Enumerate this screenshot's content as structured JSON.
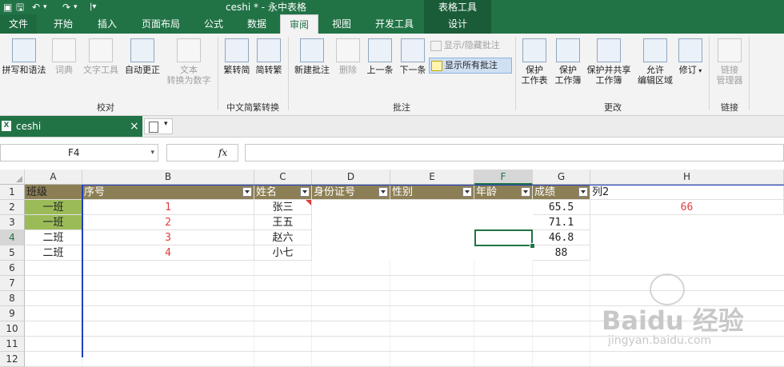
{
  "titlebar": {
    "title": "ceshi * - 永中表格",
    "context_tool": "表格工具"
  },
  "tabs": [
    "文件",
    "开始",
    "插入",
    "页面布局",
    "公式",
    "数据",
    "审阅",
    "视图",
    "开发工具",
    "设计"
  ],
  "active_tab": "审阅",
  "ribbon": {
    "proofing": {
      "spell": "拼写和语法",
      "dict": "词典",
      "text_tools": "文字工具",
      "autocorrect": "自动更正",
      "convert_l1": "文本",
      "convert_l2": "转换为数字",
      "group": "校对"
    },
    "chinese": {
      "to_trad": "繁转简",
      "to_simp": "简转繁",
      "group": "中文简繁转换"
    },
    "comments": {
      "new": "新建批注",
      "delete": "删除",
      "prev": "上一条",
      "next": "下一条",
      "show_hide": "显示/隐藏批注",
      "show_all": "显示所有批注",
      "group": "批注"
    },
    "changes": {
      "protect_sheet_l1": "保护",
      "protect_sheet_l2": "工作表",
      "protect_book_l1": "保护",
      "protect_book_l2": "工作簿",
      "protect_share_l1": "保护并共享",
      "protect_share_l2": "工作簿",
      "allow_l1": "允许",
      "allow_l2": "编辑区域",
      "revise": "修订",
      "group": "更改"
    },
    "links": {
      "manager_l1": "链接",
      "manager_l2": "管理器",
      "group": "链接"
    }
  },
  "doc_tab": {
    "name": "ceshi",
    "close": "×"
  },
  "formula_bar": {
    "name_box": "F4",
    "fx": "fx",
    "formula": ""
  },
  "columns": [
    "A",
    "B",
    "C",
    "D",
    "E",
    "F",
    "G",
    "H"
  ],
  "rows": [
    "1",
    "2",
    "3",
    "4",
    "5",
    "6",
    "7",
    "8",
    "9",
    "10",
    "11",
    "12"
  ],
  "header_row": {
    "A": "班级",
    "B": "序号",
    "C": "姓名",
    "D": "身份证号",
    "E": "性别",
    "F": "年龄",
    "G": "成绩",
    "H": "列2"
  },
  "data_rows": [
    {
      "A": "一班",
      "B": "1",
      "C": "张三",
      "G": "65.5",
      "H": "66"
    },
    {
      "A": "一班",
      "B": "2",
      "C": "王五",
      "G": "71.1",
      "H": ""
    },
    {
      "A": "二班",
      "B": "3",
      "C": "赵六",
      "G": "46.8",
      "H": ""
    },
    {
      "A": "二班",
      "B": "4",
      "C": "小七",
      "G": "88",
      "H": ""
    }
  ],
  "watermark": {
    "brand": "Baidu 经验",
    "url": "jingyan.baidu.com"
  },
  "colors": {
    "app_green": "#217346",
    "header_fill": "#8d7f55",
    "highlight_fill": "#9bbb59",
    "red_text": "#e03c3c",
    "selection_blue": "#1f3fbf"
  }
}
